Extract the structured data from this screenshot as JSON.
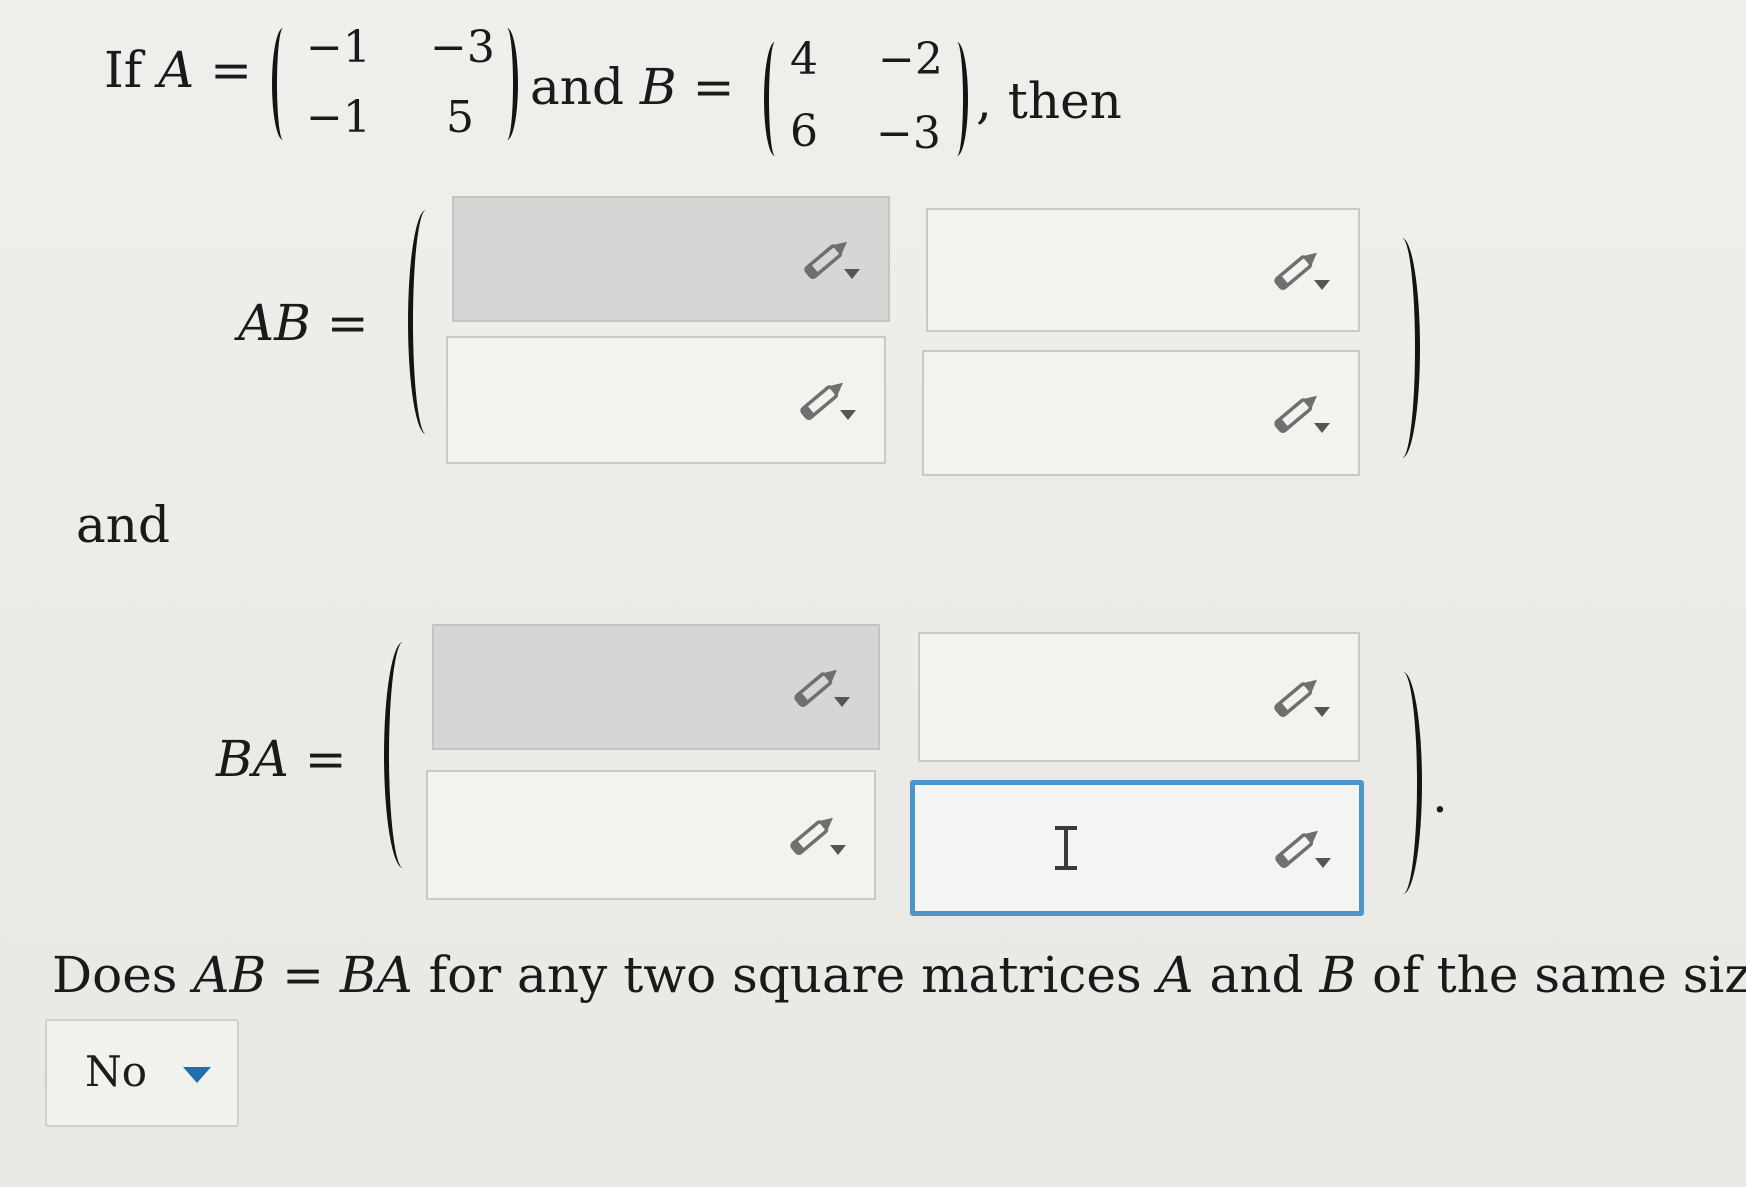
{
  "question": {
    "if_text": "If ",
    "A": "A",
    "eq": " = ",
    "and_mid": " and ",
    "B": "B",
    "then": ", then",
    "matrix_A": [
      [
        "−1",
        "−3"
      ],
      [
        "−1",
        "5"
      ]
    ],
    "matrix_B": [
      [
        "4",
        "−2"
      ],
      [
        "6",
        "−3"
      ]
    ]
  },
  "ab_label": "AB =",
  "and_label": "and",
  "ba_label": "BA =",
  "trailing_period": ".",
  "ab_cells": [
    {
      "value": "",
      "icon": "pencil-dropdown-icon",
      "shaded": true
    },
    {
      "value": "",
      "icon": "pencil-dropdown-icon",
      "shaded": false
    },
    {
      "value": "",
      "icon": "pencil-dropdown-icon",
      "shaded": false
    },
    {
      "value": "",
      "icon": "pencil-dropdown-icon",
      "shaded": false
    }
  ],
  "ba_cells": [
    {
      "value": "",
      "icon": "pencil-dropdown-icon",
      "shaded": true
    },
    {
      "value": "",
      "icon": "pencil-dropdown-icon",
      "shaded": false
    },
    {
      "value": "",
      "icon": "pencil-dropdown-icon",
      "shaded": false
    },
    {
      "value": "",
      "icon": "pencil-dropdown-icon",
      "shaded": false,
      "focused": true
    }
  ],
  "question2": {
    "p1": "Does ",
    "AB": "AB",
    "eq": " = ",
    "BA": "BA",
    "p2": " for any two square matrices ",
    "A": "A",
    "and": " and ",
    "B": "B",
    "p3": " of the same size?"
  },
  "answer_dropdown": {
    "selected": "No"
  },
  "colors": {
    "focus_border": "#4f94c8",
    "caret": "#1f6fae",
    "shaded_cell": "#d6d6d4"
  }
}
